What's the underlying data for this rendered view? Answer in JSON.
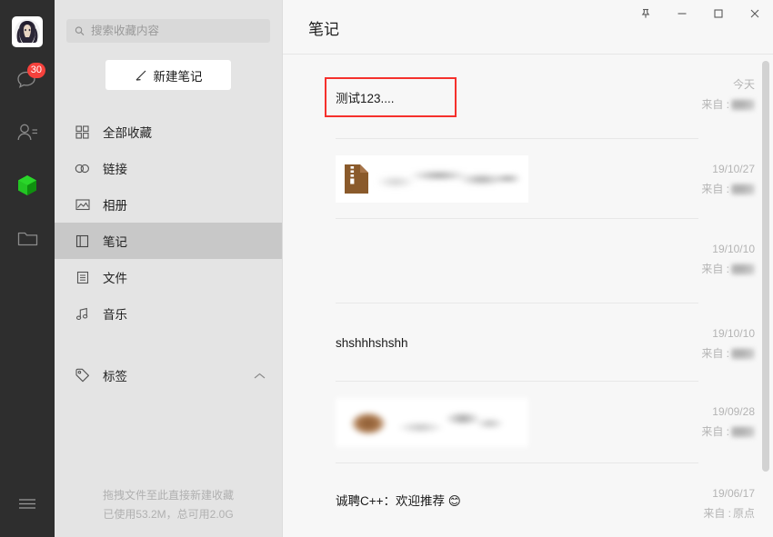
{
  "window": {
    "controls": [
      {
        "name": "pin-button",
        "glyph": "pin"
      },
      {
        "name": "minimize-button",
        "glyph": "minimize"
      },
      {
        "name": "maximize-button",
        "glyph": "maximize"
      },
      {
        "name": "close-button",
        "glyph": "close"
      }
    ]
  },
  "rail": {
    "avatar_alt": "user-avatar",
    "items": [
      {
        "icon": "chat-icon",
        "badge": "30"
      },
      {
        "icon": "contacts-icon",
        "badge": ""
      },
      {
        "icon": "favorites-box-icon",
        "badge": "",
        "active": true,
        "color": "#25c226"
      },
      {
        "icon": "files-icon",
        "badge": ""
      }
    ],
    "menu_icon": "hamburger-menu-icon"
  },
  "sidebar": {
    "search": {
      "placeholder": "搜索收藏内容",
      "value": "",
      "icon": "search-icon"
    },
    "new_note": {
      "label": "新建笔记",
      "icon": "pencil-icon"
    },
    "nav": [
      {
        "label": "全部收藏",
        "icon": "grid-icon",
        "active": false
      },
      {
        "label": "链接",
        "icon": "link-icon",
        "active": false
      },
      {
        "label": "相册",
        "icon": "image-icon",
        "active": false
      },
      {
        "label": "笔记",
        "icon": "note-icon",
        "active": true
      },
      {
        "label": "文件",
        "icon": "file-icon",
        "active": false
      },
      {
        "label": "音乐",
        "icon": "music-icon",
        "active": false
      }
    ],
    "tags": {
      "label": "标签",
      "icon": "tag-icon",
      "chevron": "chevron-up-icon"
    },
    "footer": {
      "line1": "拖拽文件至此直接新建收藏",
      "line2": "已使用53.2M，总可用2.0G"
    }
  },
  "main": {
    "title": "笔记",
    "from_label": "来自 :",
    "items": [
      {
        "kind": "text",
        "text": "测试123....",
        "highlighted": true,
        "date": "今天",
        "from": "",
        "from_blurred": true
      },
      {
        "kind": "attachment",
        "text": "",
        "attachment_icon": "zip-file-icon",
        "attachment_color": "#8a5a2b",
        "highlighted": false,
        "date": "19/10/27",
        "from": "",
        "from_blurred": true
      },
      {
        "kind": "empty",
        "text": "",
        "highlighted": false,
        "date": "19/10/10",
        "from": "",
        "from_blurred": true
      },
      {
        "kind": "text",
        "text": "shshhhshshh",
        "highlighted": false,
        "date": "19/10/10",
        "from": "",
        "from_blurred": true
      },
      {
        "kind": "image",
        "text": "",
        "highlighted": false,
        "date": "19/09/28",
        "from": "",
        "from_blurred": true
      },
      {
        "kind": "text",
        "text": "诚聘C++：欢迎推荐 😊",
        "highlighted": false,
        "date": "19/06/17",
        "from": "原点",
        "from_blurred": false
      }
    ]
  },
  "colors": {
    "accent_green": "#25c226",
    "badge_red": "#f5413c",
    "highlight_red": "#f5302c",
    "sidebar_bg": "#e4e4e4",
    "rail_bg": "#2e2e2e",
    "main_bg": "#f7f7f7"
  }
}
